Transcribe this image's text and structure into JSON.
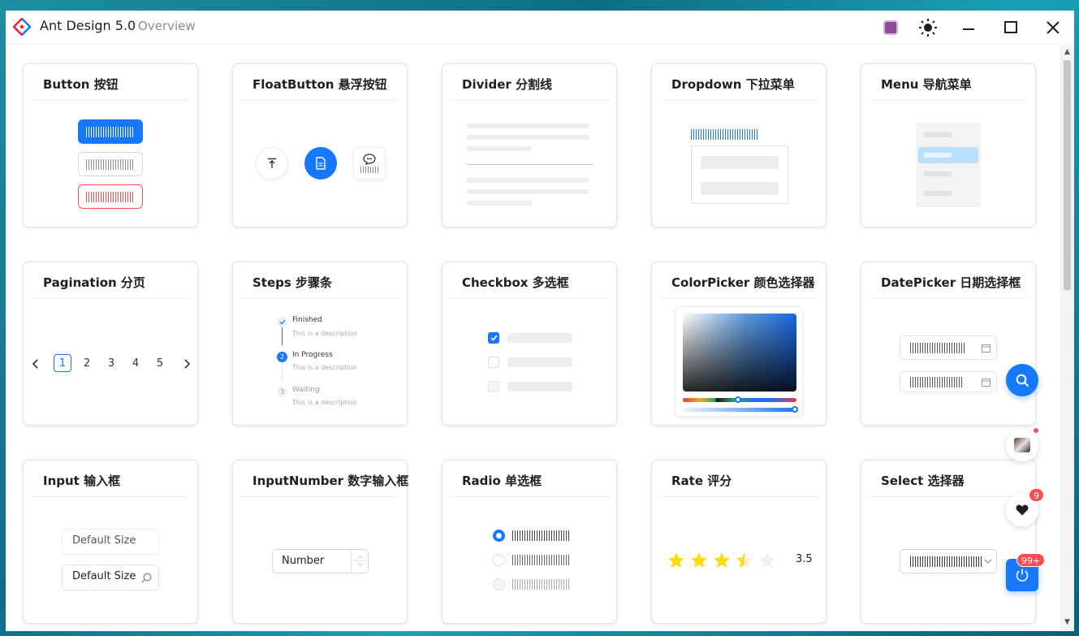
{
  "app": {
    "title": "Ant Design 5.0",
    "subtitle": "Overview",
    "accent": "#1677ff",
    "theme_swatch": "#8f4a9b"
  },
  "cards": [
    {
      "title": "Button 按钮"
    },
    {
      "title": "FloatButton 悬浮按钮"
    },
    {
      "title": "Divider 分割线"
    },
    {
      "title": "Dropdown 下拉菜单"
    },
    {
      "title": "Menu 导航菜单"
    },
    {
      "title": "Pagination 分页"
    },
    {
      "title": "Steps 步骤条"
    },
    {
      "title": "Checkbox 多选框"
    },
    {
      "title": "ColorPicker 颜色选择器"
    },
    {
      "title": "DatePicker 日期选择框"
    },
    {
      "title": "Input 输入框"
    },
    {
      "title": "InputNumber 数字输入框"
    },
    {
      "title": "Radio 单选框"
    },
    {
      "title": "Rate 评分"
    },
    {
      "title": "Select 选择器"
    }
  ],
  "pagination": {
    "pages": [
      "1",
      "2",
      "3",
      "4",
      "5"
    ],
    "current": "1"
  },
  "steps": [
    {
      "title": "Finished",
      "description": "This is a description",
      "status": "finish"
    },
    {
      "title": "In Progress",
      "description": "This is a description",
      "status": "process",
      "number": "2"
    },
    {
      "title": "Waiting",
      "description": "This is a description",
      "status": "wait",
      "number": "3"
    }
  ],
  "input": {
    "placeholder_1": "Default Size",
    "placeholder_2": "Default Size"
  },
  "input_number": {
    "placeholder": "Number"
  },
  "rate": {
    "value": 3.5,
    "max": 5,
    "label": "3.5"
  },
  "float_buttons": {
    "heart_badge": "9",
    "power_badge": "99+"
  },
  "icons": [
    "ant-logo-icon",
    "theme-color-icon",
    "sun-icon",
    "minimize-icon",
    "maximize-icon",
    "close-icon",
    "vertical-align-top-icon",
    "file-icon",
    "comment-icon",
    "calendar-icon",
    "search-icon",
    "heart-icon",
    "power-icon",
    "chevron-left-icon",
    "chevron-right-icon",
    "check-icon",
    "star-icon"
  ]
}
